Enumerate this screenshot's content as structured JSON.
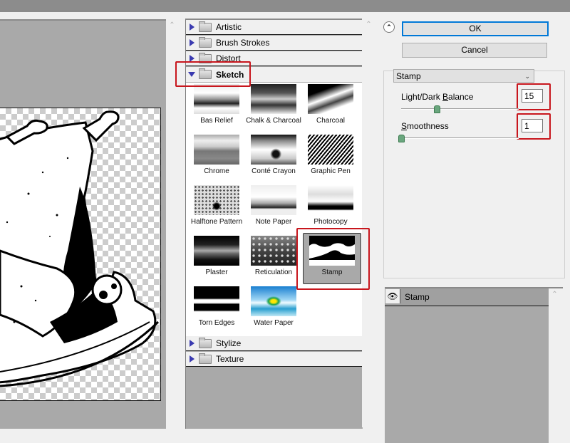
{
  "preview": {
    "description": "Stamp-filtered roast chicken illustration on transparent checkerboard"
  },
  "gallery": {
    "categories_top": [
      {
        "label": "Artistic",
        "expanded": false
      },
      {
        "label": "Brush Strokes",
        "expanded": false
      },
      {
        "label": "Distort",
        "expanded": false
      },
      {
        "label": "Sketch",
        "expanded": true
      }
    ],
    "categories_bottom": [
      {
        "label": "Stylize",
        "expanded": false
      },
      {
        "label": "Texture",
        "expanded": false
      }
    ],
    "filters": [
      {
        "label": "Bas Relief"
      },
      {
        "label": "Chalk & Charcoal"
      },
      {
        "label": "Charcoal"
      },
      {
        "label": "Chrome"
      },
      {
        "label": "Conté Crayon"
      },
      {
        "label": "Graphic Pen"
      },
      {
        "label": "Halftone Pattern"
      },
      {
        "label": "Note Paper"
      },
      {
        "label": "Photocopy"
      },
      {
        "label": "Plaster"
      },
      {
        "label": "Reticulation"
      },
      {
        "label": "Stamp",
        "selected": true
      },
      {
        "label": "Torn Edges"
      },
      {
        "label": "Water Paper"
      }
    ]
  },
  "dialog": {
    "ok_label": "OK",
    "cancel_label": "Cancel",
    "collapse_icon": "double-chevron-up-icon",
    "filter_select": "Stamp",
    "params": {
      "light_dark_balance": {
        "label_pre": "Light/Dark ",
        "label_u": "B",
        "label_post": "alance",
        "value": "15",
        "slider_fraction": 0.3
      },
      "smoothness": {
        "label_pre": "",
        "label_u": "S",
        "label_post": "moothness",
        "value": "1",
        "slider_fraction": 0.0
      }
    }
  },
  "layers": {
    "items": [
      {
        "label": "Stamp",
        "visible": true
      }
    ]
  },
  "highlight_color": "#c8161d"
}
